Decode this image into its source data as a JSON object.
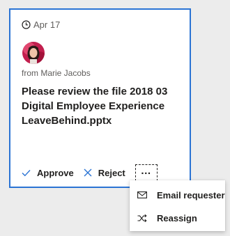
{
  "card": {
    "date": "Apr 17",
    "from": "from Marie Jacobs",
    "title": "Please review the file 2018 03 Digital Employee Experience LeaveBehind.pptx",
    "actions": {
      "approve_label": "Approve",
      "reject_label": "Reject",
      "more_label": "…"
    }
  },
  "menu": {
    "items": [
      {
        "label": "Email requester",
        "icon": "envelope-icon"
      },
      {
        "label": "Reassign",
        "icon": "shuffle-icon"
      }
    ]
  },
  "colors": {
    "accent": "#2a73d4",
    "background": "#ececec",
    "card": "#ffffff",
    "text": "#201f1e",
    "muted": "#605e5c"
  }
}
